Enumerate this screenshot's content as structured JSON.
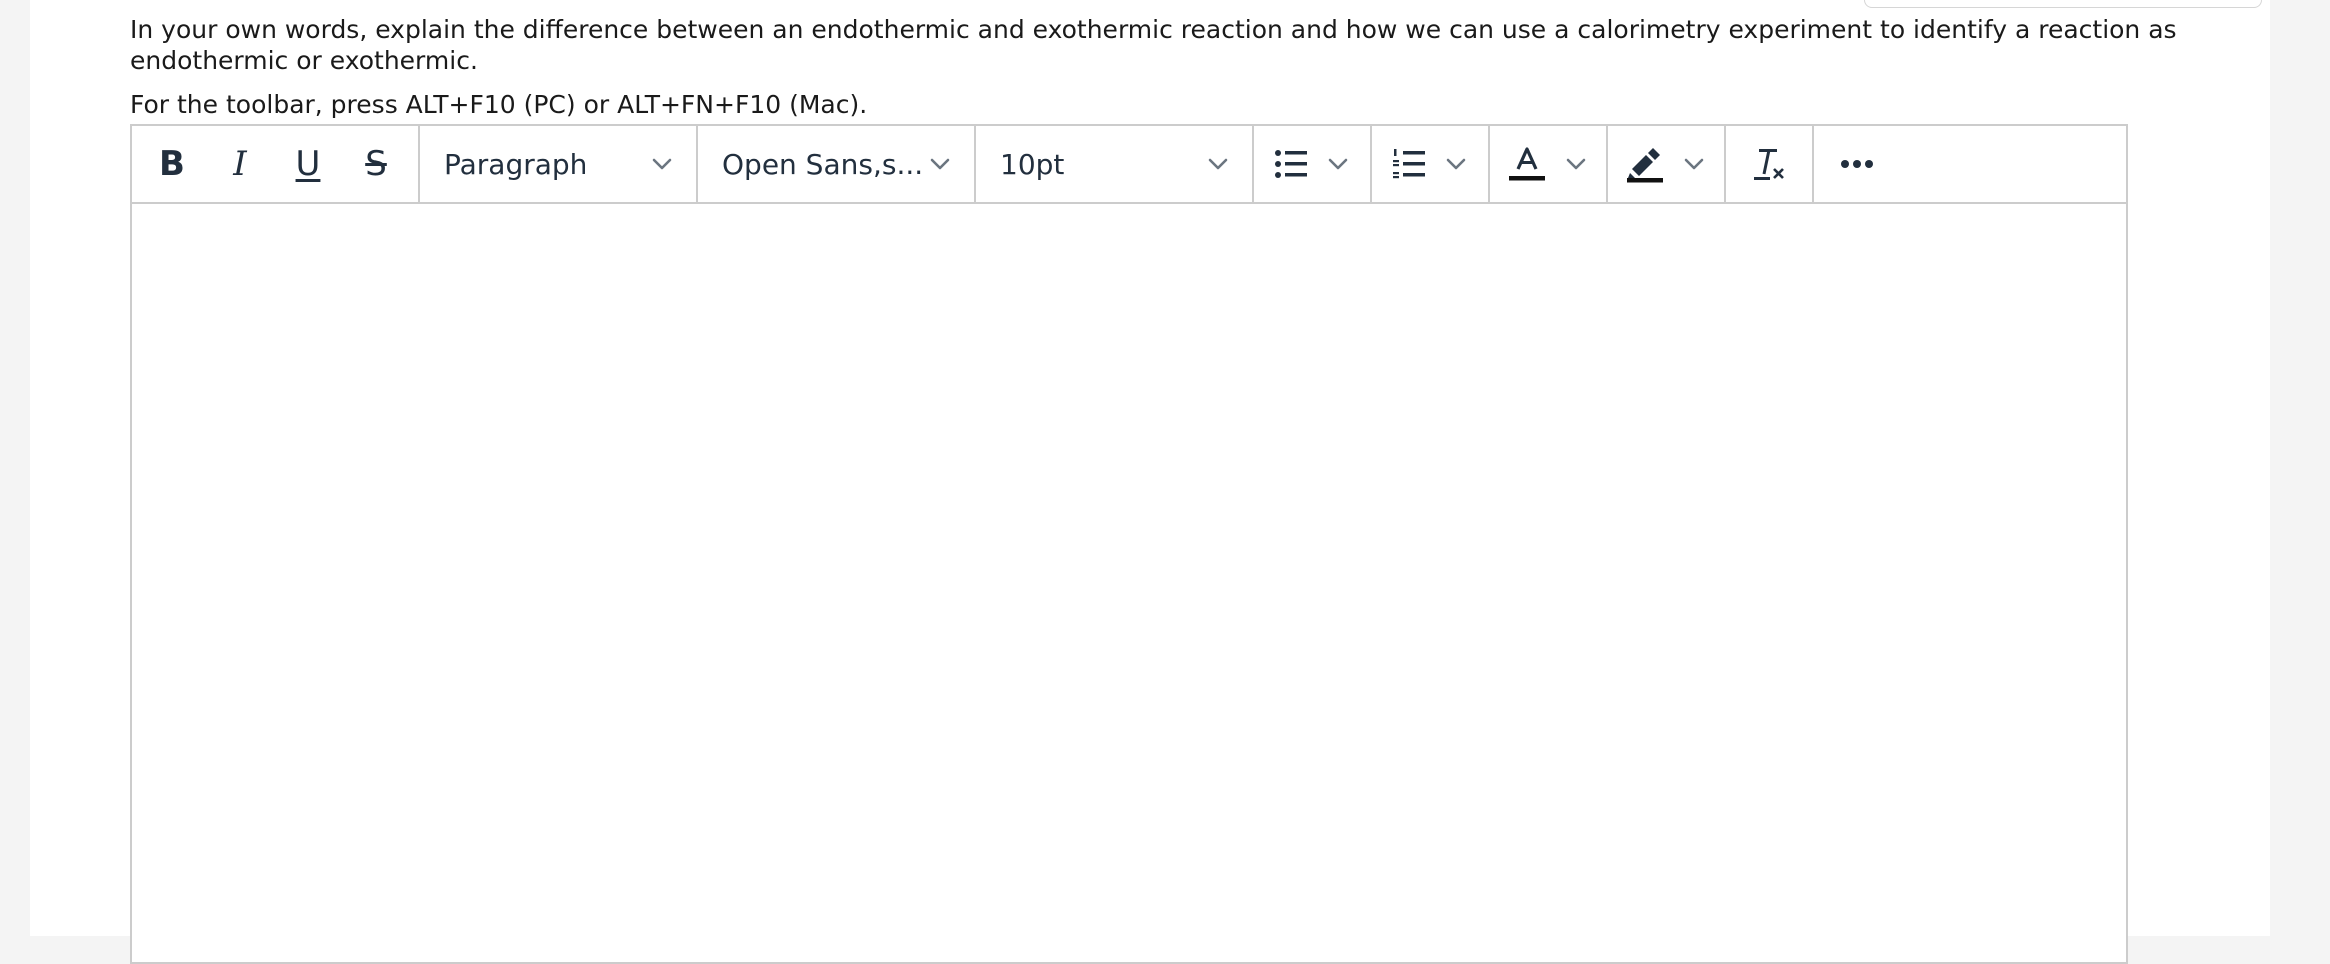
{
  "question": {
    "text": "In your own words, explain the difference between an endothermic and exothermic reaction and how we can use a calorimetry experiment to identify a reaction as endothermic or exothermic."
  },
  "hint": {
    "text": "For the toolbar, press ALT+F10 (PC) or ALT+FN+F10 (Mac)."
  },
  "toolbar": {
    "bold_label": "B",
    "italic_label": "I",
    "underline_label": "U",
    "strike_label": "S",
    "block_format": "Paragraph",
    "font_family": "Open Sans,s...",
    "font_size": "10pt",
    "more_label": "•••",
    "clear_format_label": "I"
  },
  "icons": {
    "bullet_list": "bullet-list-icon",
    "numbered_list": "numbered-list-icon",
    "text_color": "text-color-icon",
    "highlight": "highlight-icon",
    "clear_formatting": "clear-formatting-icon",
    "chevron": "chevron-down-icon"
  },
  "colors": {
    "toolbar_icon": "#222f3e",
    "border": "#cccccc"
  }
}
